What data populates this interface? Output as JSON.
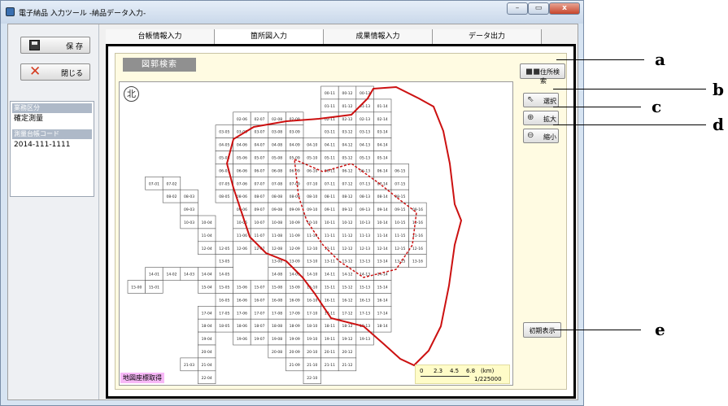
{
  "window": {
    "title": "電子納品 入力ツール -納品データ入力-",
    "controls": {
      "minimize": "–",
      "maximize": "▭",
      "close": "x"
    }
  },
  "sidebar": {
    "save_label": "保 存",
    "close_label": "閉じる",
    "info": [
      {
        "label": "業務区分",
        "value": "確定測量"
      },
      {
        "label": "測量台帳コード",
        "value": "2014-111-1111"
      }
    ]
  },
  "tabs": [
    "台帳情報入力",
    "箇所図入力",
    "成果情報入力",
    "データ出力"
  ],
  "active_tab": "箇所図入力",
  "panel": {
    "title": "図郭検索",
    "address_search": "住所検索",
    "select": "選択",
    "zoom_in": "拡大",
    "zoom_out": "縮小",
    "initial_display": "初期表示",
    "coord_label": "地図座標取得",
    "compass": "北",
    "scale": {
      "ticks": [
        "0",
        "2.3",
        "4.5",
        "6.8"
      ],
      "unit": "(km)",
      "ratio": "1/225000"
    }
  },
  "callouts": [
    "a",
    "b",
    "c",
    "d",
    "e"
  ],
  "colors": {
    "boundary": "#cc1111",
    "label_bg": "#f7b8f7",
    "panel_bg": "#fffbe2",
    "scale_bg": "#fffcc8"
  },
  "grid_rows": [
    {
      "row": 0,
      "cols": [
        11,
        12,
        13
      ]
    },
    {
      "row": 1,
      "cols": [
        11,
        12,
        13,
        14
      ]
    },
    {
      "row": 2,
      "cols": [
        6,
        7,
        8,
        9,
        11,
        12,
        13,
        14
      ]
    },
    {
      "row": 3,
      "cols": [
        5,
        6,
        7,
        8,
        9,
        11,
        12,
        13,
        14
      ]
    },
    {
      "row": 4,
      "cols": [
        5,
        6,
        7,
        8,
        9,
        10,
        11,
        12,
        13,
        14
      ]
    },
    {
      "row": 5,
      "cols": [
        5,
        6,
        7,
        8,
        9,
        10,
        11,
        12,
        13,
        14
      ]
    },
    {
      "row": 6,
      "cols": [
        5,
        6,
        7,
        8,
        9,
        10,
        11,
        12,
        13,
        14,
        15
      ]
    },
    {
      "row": 7,
      "cols": [
        1,
        2,
        5,
        6,
        7,
        8,
        9,
        10,
        11,
        12,
        13,
        14,
        15
      ]
    },
    {
      "row": 8,
      "cols": [
        2,
        3,
        5,
        6,
        7,
        8,
        9,
        10,
        11,
        12,
        13,
        14,
        15
      ]
    },
    {
      "row": 9,
      "cols": [
        3,
        6,
        7,
        8,
        9,
        10,
        11,
        12,
        13,
        14,
        15,
        16
      ]
    },
    {
      "row": 10,
      "cols": [
        3,
        4,
        6,
        7,
        8,
        9,
        10,
        11,
        12,
        13,
        14,
        15,
        16
      ]
    },
    {
      "row": 11,
      "cols": [
        4,
        6,
        7,
        8,
        9,
        10,
        11,
        12,
        13,
        14,
        15,
        16
      ]
    },
    {
      "row": 12,
      "cols": [
        4,
        5,
        6,
        7,
        8,
        9,
        10,
        11,
        12,
        13,
        14,
        15,
        16
      ]
    },
    {
      "row": 13,
      "cols": [
        5,
        8,
        9,
        10,
        11,
        12,
        13,
        14,
        15,
        16
      ]
    },
    {
      "row": 14,
      "cols": [
        1,
        2,
        3,
        4,
        5,
        8,
        9,
        10,
        11,
        12,
        13,
        14
      ]
    },
    {
      "row": 15,
      "cols": [
        0,
        1,
        4,
        5,
        6,
        7,
        8,
        9,
        10,
        11,
        12,
        13,
        14
      ]
    },
    {
      "row": 16,
      "cols": [
        5,
        6,
        7,
        8,
        9,
        10,
        11,
        12,
        13,
        14
      ]
    },
    {
      "row": 17,
      "cols": [
        4,
        5,
        6,
        7,
        8,
        9,
        10,
        11,
        12,
        13,
        14
      ]
    },
    {
      "row": 18,
      "cols": [
        4,
        5,
        6,
        7,
        8,
        9,
        10,
        11,
        12,
        13,
        14
      ]
    },
    {
      "row": 19,
      "cols": [
        4,
        6,
        7,
        8,
        9,
        10,
        11,
        12,
        13
      ]
    },
    {
      "row": 20,
      "cols": [
        4,
        8,
        9,
        10,
        11,
        12
      ]
    },
    {
      "row": 21,
      "cols": [
        3,
        4,
        9,
        10,
        11,
        12
      ]
    },
    {
      "row": 22,
      "cols": [
        4,
        10
      ]
    }
  ]
}
